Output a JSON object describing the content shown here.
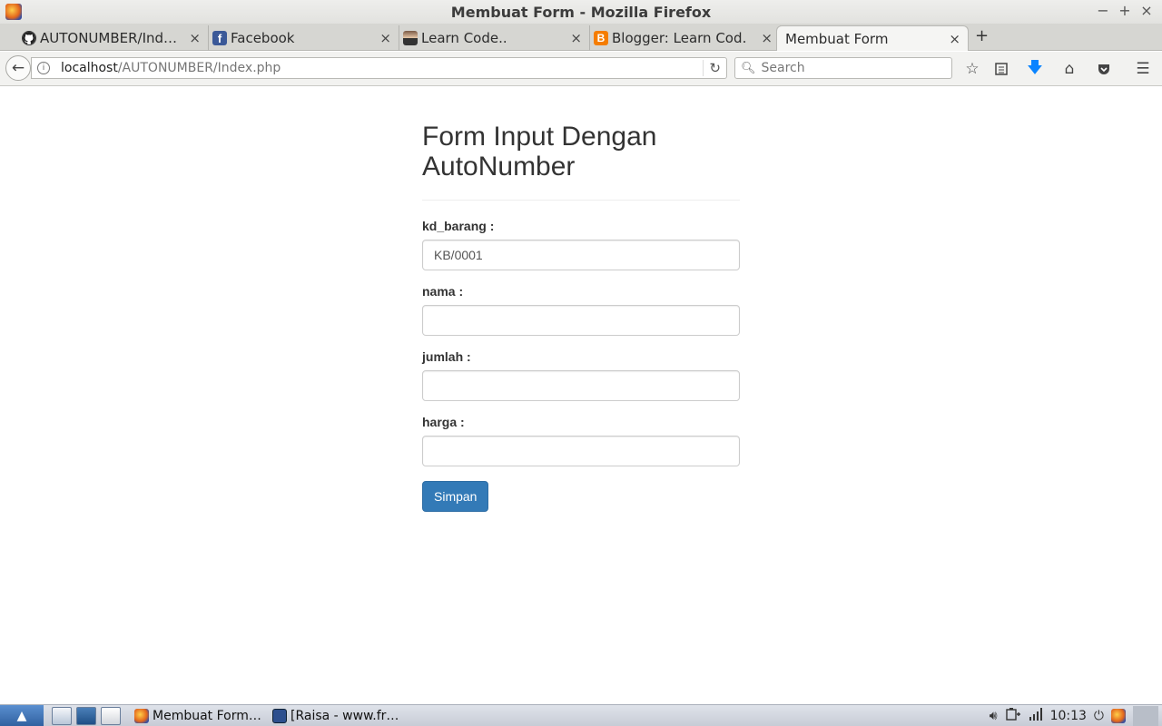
{
  "window": {
    "title": "Membuat Form - Mozilla Firefox",
    "controls": {
      "minimize": "−",
      "maximize": "+",
      "close": "×"
    }
  },
  "tabs": [
    {
      "label": "AUTONUMBER/Ind…",
      "icon": "github-icon",
      "active": false
    },
    {
      "label": "Facebook",
      "icon": "facebook-icon",
      "active": false
    },
    {
      "label": "Learn Code..",
      "icon": "avatar-icon",
      "active": false
    },
    {
      "label": "Blogger: Learn Cod…",
      "icon": "blogger-icon",
      "active": false
    },
    {
      "label": "Membuat Form",
      "icon": "",
      "active": true
    }
  ],
  "tab_close": "×",
  "new_tab": "+",
  "navbar": {
    "url_host": "localhost",
    "url_path": "/AUTONUMBER/Index.php",
    "search_placeholder": "Search"
  },
  "form": {
    "title": "Form Input Dengan AutoNumber",
    "fields": [
      {
        "label": "kd_barang :",
        "value": "KB/0001"
      },
      {
        "label": "nama :",
        "value": ""
      },
      {
        "label": "jumlah :",
        "value": ""
      },
      {
        "label": "harga :",
        "value": ""
      }
    ],
    "submit_label": "Simpan"
  },
  "taskbar": {
    "tasks": [
      {
        "label": "Membuat Form…",
        "icon": "firefox-icon"
      },
      {
        "label": "[Raisa - www.fr…",
        "icon": "media-player-icon"
      }
    ],
    "clock": "10:13"
  },
  "colors": {
    "primary_button": "#337ab7",
    "facebook": "#3b5998",
    "blogger": "#f57d00",
    "download_arrow": "#0a84ff"
  }
}
